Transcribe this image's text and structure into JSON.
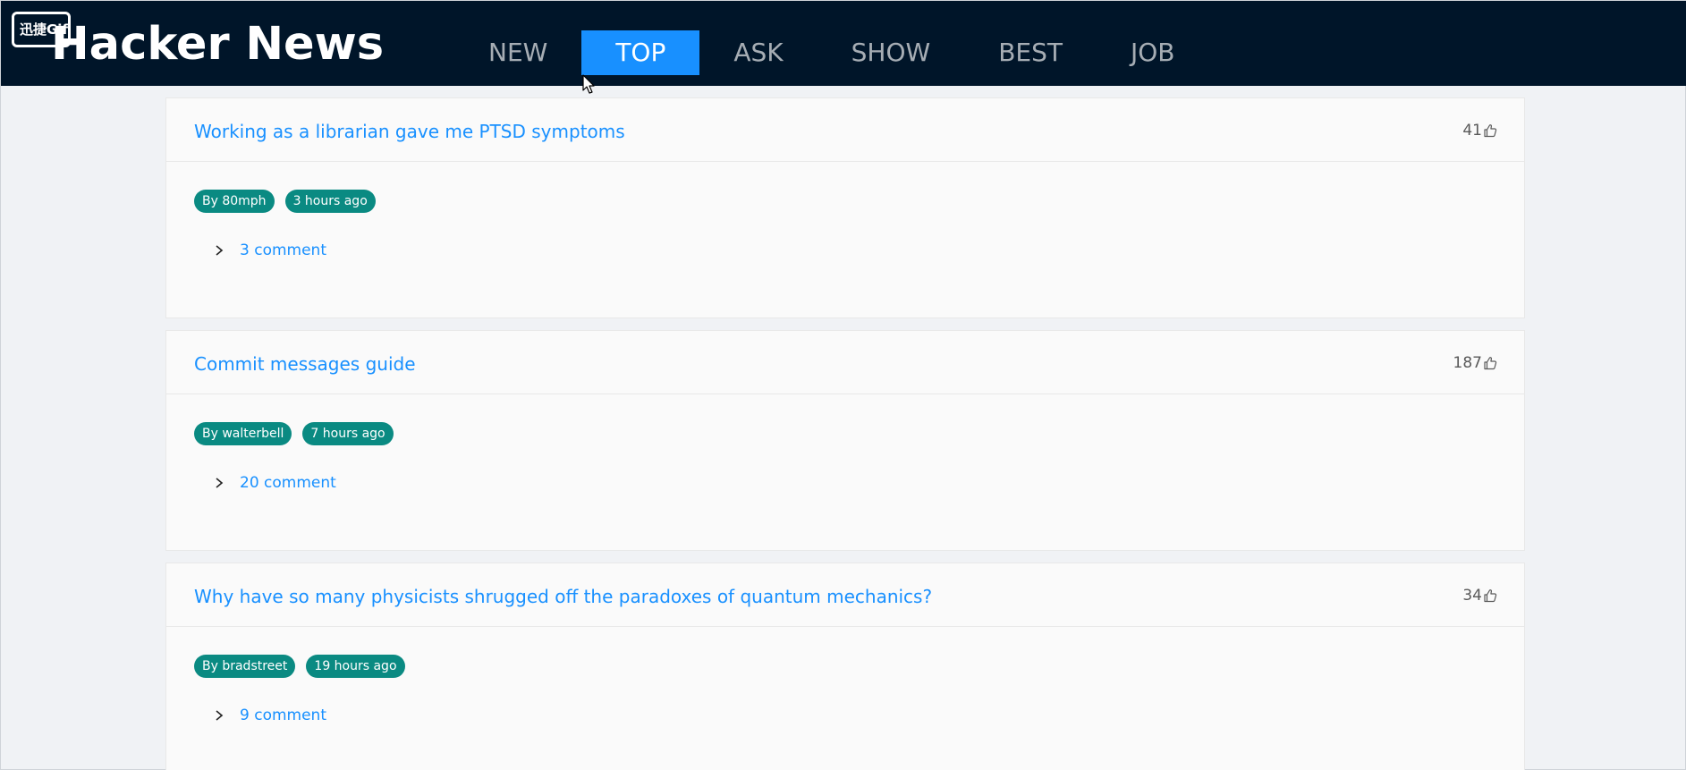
{
  "watermark": "迅捷Gif",
  "brand": "Hacker News",
  "nav": [
    {
      "label": "NEW",
      "active": false
    },
    {
      "label": "TOP",
      "active": true
    },
    {
      "label": "ASK",
      "active": false
    },
    {
      "label": "SHOW",
      "active": false
    },
    {
      "label": "BEST",
      "active": false
    },
    {
      "label": "JOB",
      "active": false
    }
  ],
  "stories": [
    {
      "title": "Working as a librarian gave me PTSD symptoms",
      "score": "41",
      "author": "By 80mph",
      "time": "3 hours ago",
      "comments": "3 comment"
    },
    {
      "title": "Commit messages guide",
      "score": "187",
      "author": "By walterbell",
      "time": "7 hours ago",
      "comments": "20 comment"
    },
    {
      "title": "Why have so many physicists shrugged off the paradoxes of quantum mechanics?",
      "score": "34",
      "author": "By bradstreet",
      "time": "19 hours ago",
      "comments": "9 comment"
    }
  ],
  "icons": {
    "score": "like-icon",
    "expand": "chevron-right-icon"
  },
  "colors": {
    "header_bg": "#001529",
    "accent": "#1890ff",
    "tag_bg": "#0a8a82"
  }
}
